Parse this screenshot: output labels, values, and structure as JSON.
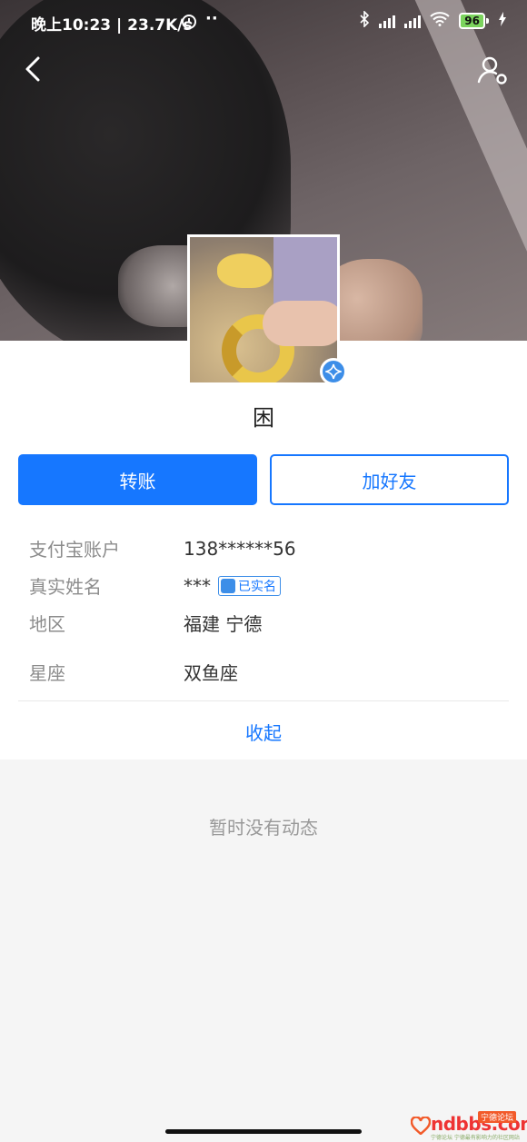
{
  "status_bar": {
    "time": "晚上10:23 | 23.7K/s",
    "battery": "96",
    "icons": [
      "alarm-icon",
      "more-icon",
      "bluetooth-icon",
      "signal-hd-icon",
      "signal-hd-icon",
      "wifi-icon",
      "battery-icon",
      "charging-icon"
    ]
  },
  "nav": {
    "back_icon": "chevron-left-icon",
    "profile_icon": "user-settings-icon"
  },
  "profile": {
    "nickname": "困",
    "badge_icon": "verified-star-icon"
  },
  "actions": {
    "transfer": "转账",
    "add_friend": "加好友"
  },
  "info": {
    "account": {
      "label": "支付宝账户",
      "value": "138******56"
    },
    "real_name": {
      "label": "真实姓名",
      "value": "***",
      "tag": "已实名"
    },
    "region": {
      "label": "地区",
      "value": "福建 宁德"
    },
    "zodiac": {
      "label": "星座",
      "value": "双鱼座"
    }
  },
  "collapse": "收起",
  "empty_feed": "暂时没有动态",
  "watermark": {
    "text": "ndbbs.com",
    "tag": "宁德论坛",
    "sub": "宁德论坛 宁德最有影响力的社区网站"
  },
  "colors": {
    "accent": "#1677ff",
    "badge": "#3d8ee8",
    "battery": "#7bd35d"
  }
}
